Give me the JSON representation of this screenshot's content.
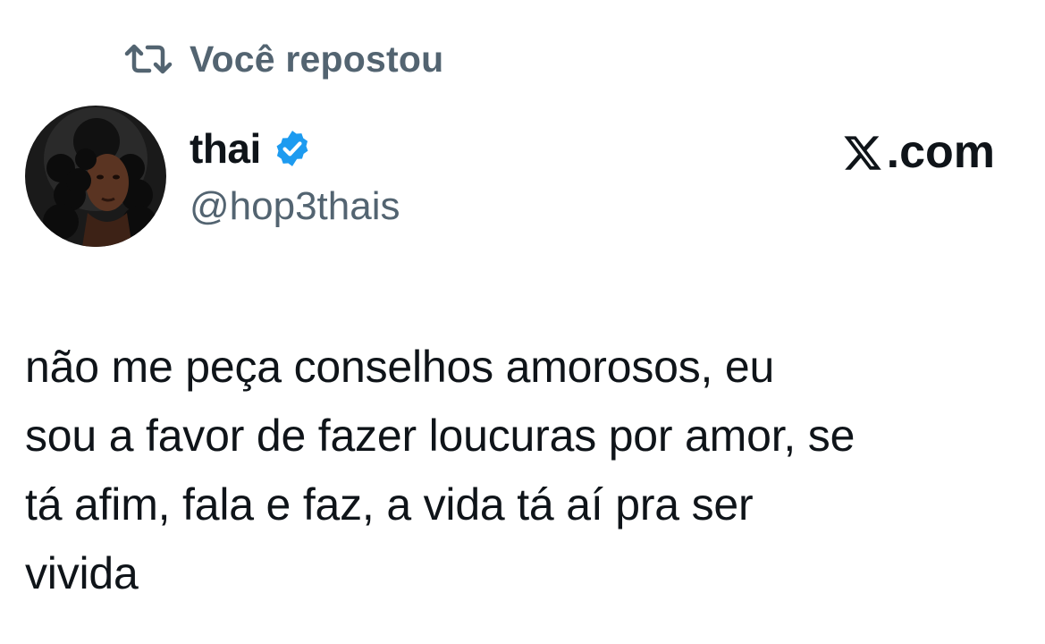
{
  "repost": {
    "icon": "repost-icon",
    "label": "Você repostou",
    "color": "#536471"
  },
  "tweet": {
    "author": {
      "display_name": "thai",
      "handle": "@hop3thais",
      "verified": true,
      "verified_color": "#1d9bf0",
      "avatar_icon": "avatar"
    },
    "brand": {
      "logo_icon": "x-logo-icon",
      "suffix": ".com"
    },
    "text_lines": [
      "não me peça conselhos amorosos, eu",
      "sou a favor de fazer loucuras por amor, se",
      "tá afim, fala e faz, a vida tá aí pra ser",
      "vivida"
    ]
  }
}
